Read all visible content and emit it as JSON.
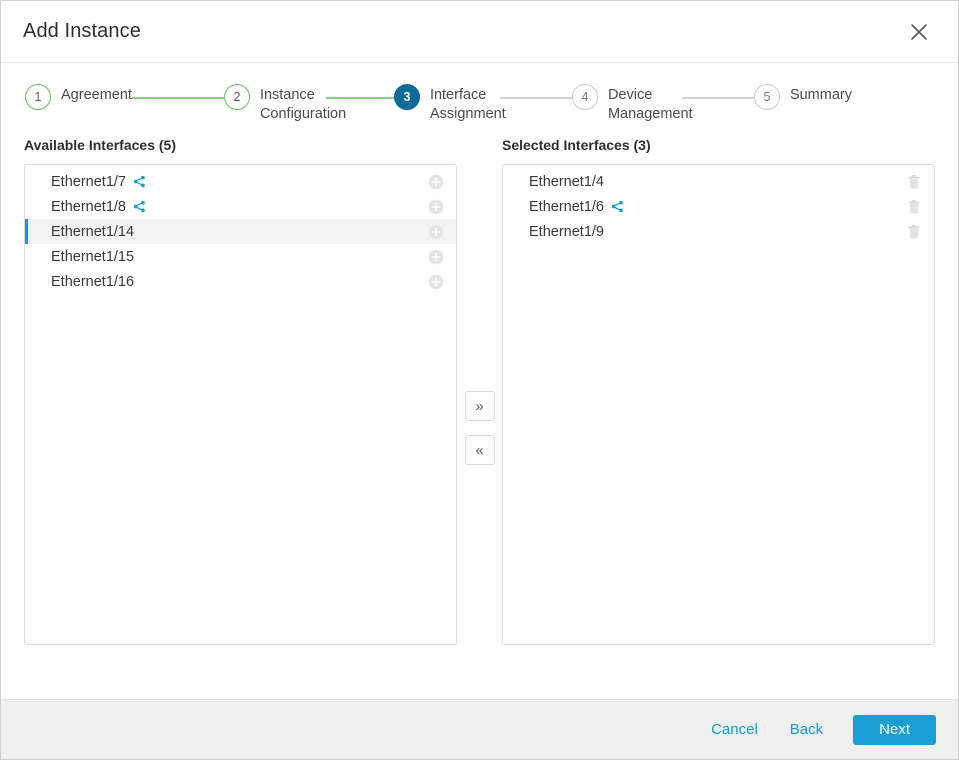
{
  "dialog": {
    "title": "Add Instance",
    "close_label": "×"
  },
  "stepper": {
    "steps": [
      {
        "number": "1",
        "label": "Agreement",
        "state": "done"
      },
      {
        "number": "2",
        "label": "Instance Configuration",
        "state": "done"
      },
      {
        "number": "3",
        "label": "Interface Assignment",
        "state": "current"
      },
      {
        "number": "4",
        "label": "Device Management",
        "state": "future"
      },
      {
        "number": "5",
        "label": "Summary",
        "state": "future"
      }
    ],
    "colors": {
      "done": "#6abf69",
      "current": "#0d6a9b",
      "future": "#c9c9c9"
    }
  },
  "available": {
    "title": "Available Interfaces (5)",
    "rows": [
      {
        "name": "Ethernet1/7",
        "shared": true,
        "selected": false
      },
      {
        "name": "Ethernet1/8",
        "shared": true,
        "selected": false
      },
      {
        "name": "Ethernet1/14",
        "shared": false,
        "selected": true
      },
      {
        "name": "Ethernet1/15",
        "shared": false,
        "selected": false
      },
      {
        "name": "Ethernet1/16",
        "shared": false,
        "selected": false
      }
    ]
  },
  "selected": {
    "title": "Selected Interfaces (3)",
    "rows": [
      {
        "name": "Ethernet1/4",
        "shared": false
      },
      {
        "name": "Ethernet1/6",
        "shared": true
      },
      {
        "name": "Ethernet1/9",
        "shared": false
      }
    ]
  },
  "transfer": {
    "move_right_label": "»",
    "move_left_label": "«"
  },
  "footer": {
    "cancel_label": "Cancel",
    "back_label": "Back",
    "next_label": "Next"
  },
  "colors": {
    "accent_blue": "#1a9fd4",
    "link_blue": "#0d9dd4",
    "selection_bar": "#00a0d1",
    "share_icon": "#1a9fd4"
  }
}
